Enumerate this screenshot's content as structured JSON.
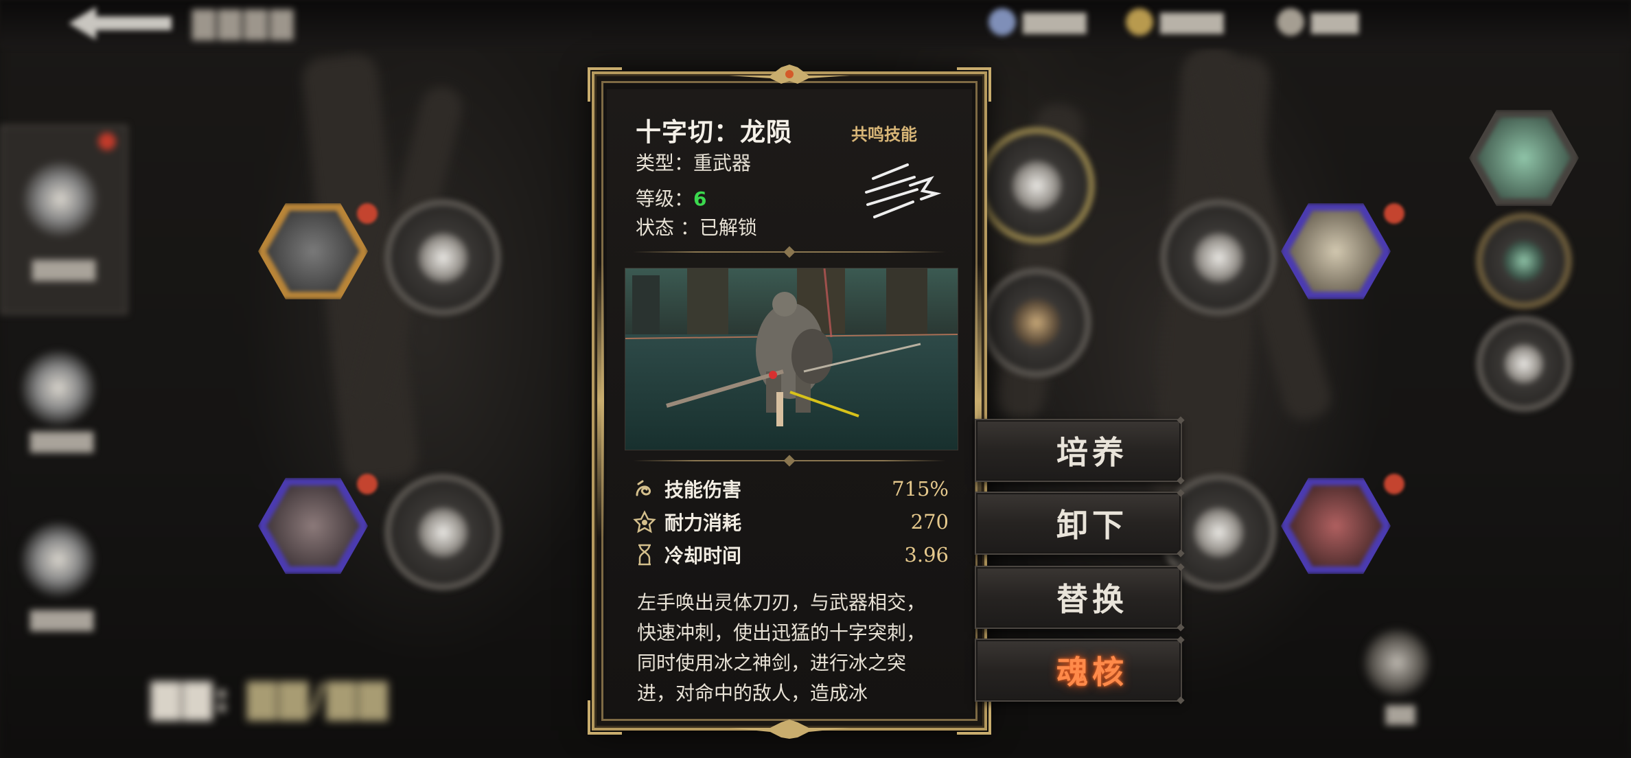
{
  "skill_card": {
    "name": "十字切：龙陨",
    "tag": "共鸣技能",
    "type_label": "类型：",
    "type_value": "重武器",
    "level_label": "等级：",
    "level_value": "6",
    "status_label": "状态 ：",
    "status_value": "已解锁",
    "stats": [
      {
        "label": "技能伤害",
        "value": "715%",
        "icon": "swirl-icon"
      },
      {
        "label": "耐力消耗",
        "value": "270",
        "icon": "stamina-icon"
      },
      {
        "label": "冷却时间",
        "value": "3.96",
        "icon": "hourglass-icon"
      }
    ],
    "description": "左手唤出灵体刀刃，与武器相交，快速冲刺，使出迅猛的十字突刺，同时使用冰之神剑，进行冰之突进，对命中的敌人，造成冰"
  },
  "actions": [
    {
      "label": "培养"
    },
    {
      "label": "卸下"
    },
    {
      "label": "替换"
    },
    {
      "label": "魂核",
      "highlight": true
    }
  ],
  "colors": {
    "accent_gold": "#c9ad6e",
    "level_green": "#3bd84e",
    "stat_value": "#e6c98d",
    "soul_core_orange": "#ff8a4a"
  }
}
